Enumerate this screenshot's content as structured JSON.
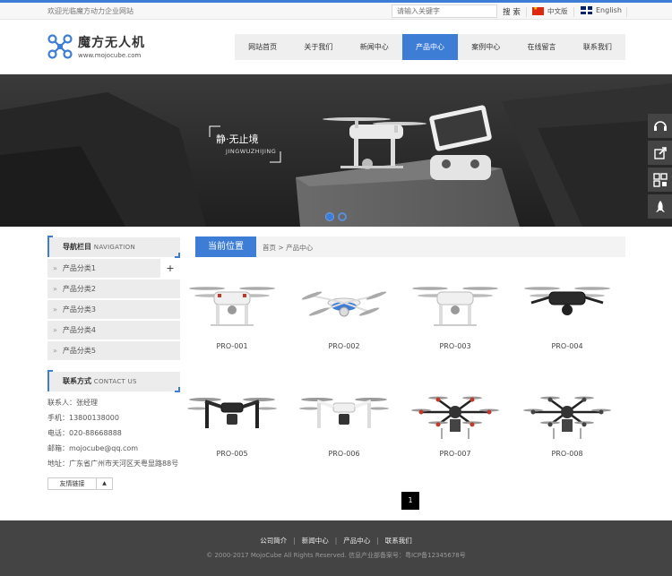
{
  "topbar": {
    "welcome": "欢迎光临魔方动力企业网站",
    "search_placeholder": "请输入关键字",
    "search_label": "搜 索",
    "lang_cn": "中文版",
    "lang_en": "English"
  },
  "brand": {
    "title": "魔方无人机",
    "url": "www.mojocube.com",
    "accent": "#3d7dd6"
  },
  "nav": [
    "网站首页",
    "关于我们",
    "新闻中心",
    "产品中心",
    "案例中心",
    "在线留言",
    "联系我们"
  ],
  "nav_active": "产品中心",
  "banner": {
    "title": "静·无止境",
    "subtitle": "JINGWUZHIJING",
    "slides": 2,
    "active_slide": 1
  },
  "sidetools": [
    "headset-icon",
    "share-icon",
    "qrcode-icon",
    "rocket-icon"
  ],
  "sidebar": {
    "nav_title": "导航栏目",
    "nav_title_en": "NAVIGATION",
    "items": [
      "产品分类1",
      "产品分类2",
      "产品分类3",
      "产品分类4",
      "产品分类5"
    ],
    "contact_title": "联系方式",
    "contact_title_en": "CONTACT US",
    "contact": {
      "person": "联系人：张经理",
      "mobile": "手机：13800138000",
      "phone": "电话：020-88668888",
      "email": "邮箱：mojocube@qq.com",
      "address": "地址：广东省广州市天河区天粤显路88号"
    },
    "links_label": "友情链接",
    "links_arrow": "▲"
  },
  "crumb": {
    "title": "当前位置",
    "home": "首页",
    "sep": ">",
    "current": "产品中心"
  },
  "products": [
    {
      "name": "PRO-001",
      "style": "white-quad"
    },
    {
      "name": "PRO-002",
      "style": "ufo-blue"
    },
    {
      "name": "PRO-003",
      "style": "white-quad-2"
    },
    {
      "name": "PRO-004",
      "style": "black-quad"
    },
    {
      "name": "PRO-005",
      "style": "black-inspire"
    },
    {
      "name": "PRO-006",
      "style": "white-inspire"
    },
    {
      "name": "PRO-007",
      "style": "hexa-red"
    },
    {
      "name": "PRO-008",
      "style": "hexa-grey"
    }
  ],
  "pagination": {
    "current": "1"
  },
  "footer": {
    "links": [
      "公司简介",
      "新闻中心",
      "产品中心",
      "联系我们"
    ],
    "copyright": "© 2000-2017 MojoCube All Rights Reserved. 信息产业部备案号：粤ICP备12345678号"
  }
}
